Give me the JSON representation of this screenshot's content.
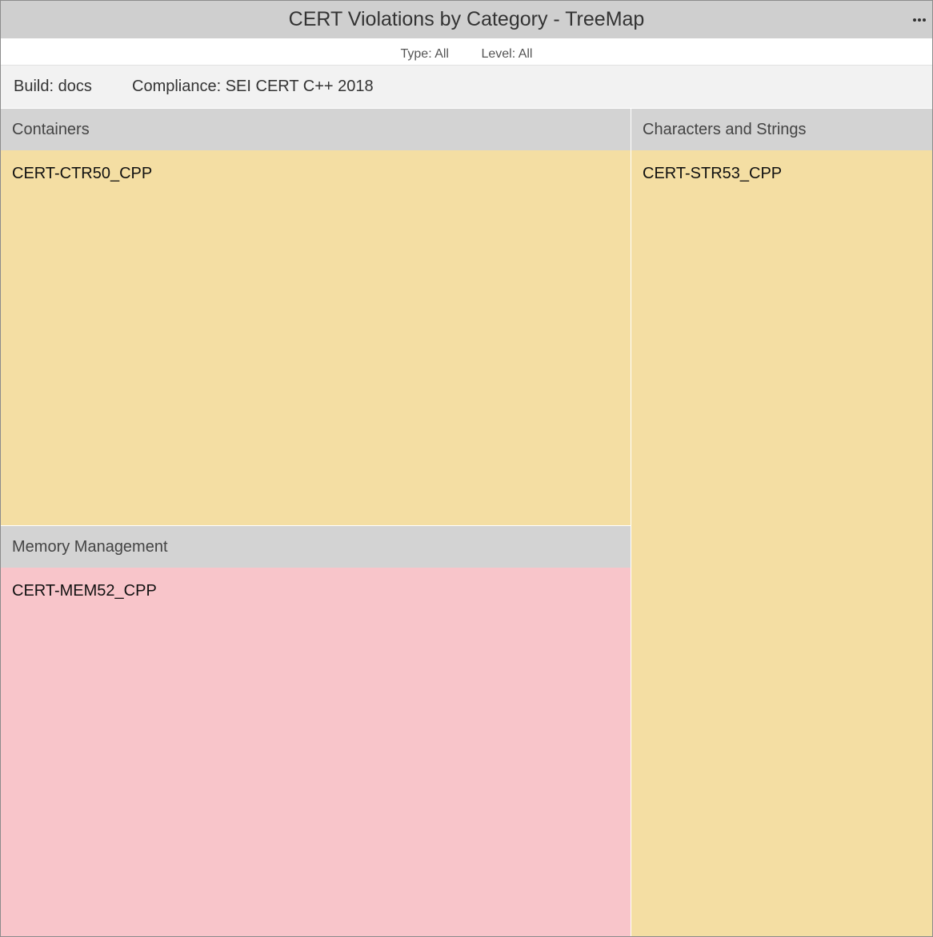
{
  "widget": {
    "title": "CERT Violations by Category - TreeMap",
    "filters": {
      "type": "Type: All",
      "level": "Level: All"
    },
    "context": {
      "build": "Build: docs",
      "compliance": "Compliance: SEI CERT C++ 2018"
    }
  },
  "treemap": {
    "groups": [
      {
        "name": "Containers",
        "cells": [
          {
            "label": "CERT-CTR50_CPP",
            "color": "#f4dea3"
          }
        ]
      },
      {
        "name": "Memory Management",
        "cells": [
          {
            "label": "CERT-MEM52_CPP",
            "color": "#f8c5ca"
          }
        ]
      },
      {
        "name": "Characters and Strings",
        "cells": [
          {
            "label": "CERT-STR53_CPP",
            "color": "#f4dea3"
          }
        ]
      }
    ]
  },
  "colors": {
    "titlebar": "#cfcfcf",
    "group_header": "#d3d3d3",
    "context_bar": "#f2f2f2"
  }
}
